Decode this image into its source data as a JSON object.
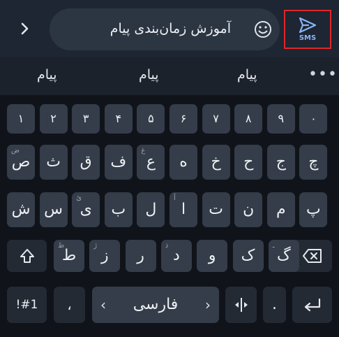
{
  "message": {
    "text": "آموزش زمان‌بندی پیام"
  },
  "send": {
    "label": "SMS"
  },
  "suggestions": [
    "پیام",
    "پیام",
    "پیام"
  ],
  "keyboard": {
    "row_numbers": [
      "۰",
      "۹",
      "۸",
      "۷",
      "۶",
      "۵",
      "۴",
      "۳",
      "۲",
      "۱"
    ],
    "row1": [
      {
        "k": "چ",
        "h": ""
      },
      {
        "k": "ج",
        "h": ""
      },
      {
        "k": "ح",
        "h": ""
      },
      {
        "k": "خ",
        "h": ""
      },
      {
        "k": "ه",
        "h": ""
      },
      {
        "k": "ع",
        "h": "غ"
      },
      {
        "k": "ف",
        "h": ""
      },
      {
        "k": "ق",
        "h": ""
      },
      {
        "k": "ث",
        "h": ""
      },
      {
        "k": "ص",
        "h": "ض"
      }
    ],
    "row2": [
      {
        "k": "پ",
        "h": ""
      },
      {
        "k": "م",
        "h": ""
      },
      {
        "k": "ن",
        "h": ""
      },
      {
        "k": "ت",
        "h": ""
      },
      {
        "k": "ا",
        "h": "آ"
      },
      {
        "k": "ل",
        "h": ""
      },
      {
        "k": "ب",
        "h": ""
      },
      {
        "k": "ی",
        "h": "ئ"
      },
      {
        "k": "س",
        "h": ""
      },
      {
        "k": "ش",
        "h": ""
      }
    ],
    "row3": [
      {
        "k": "گ",
        "h": "ـ"
      },
      {
        "k": "ک",
        "h": ""
      },
      {
        "k": "و",
        "h": ""
      },
      {
        "k": "د",
        "h": "ذ"
      },
      {
        "k": "ر",
        "h": ""
      },
      {
        "k": "ز",
        "h": "ژ"
      },
      {
        "k": "ط",
        "h": "ظ"
      }
    ],
    "symbols_label": "!#1",
    "comma": "،",
    "space_label": "فارسی",
    "period": "."
  }
}
